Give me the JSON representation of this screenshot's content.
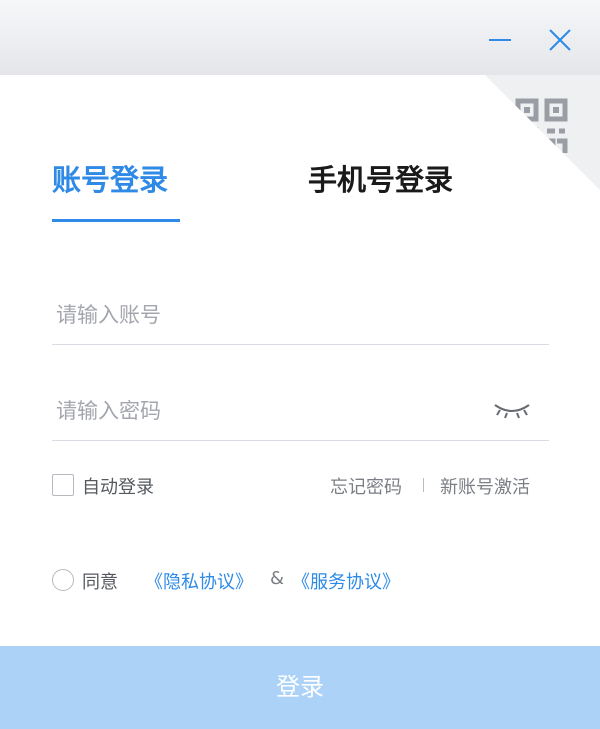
{
  "window": {
    "minimize_icon": "minimize-icon",
    "close_icon": "close-icon"
  },
  "qr_login": {
    "icon": "qr-code-icon"
  },
  "tabs": [
    {
      "label": "账号登录",
      "active": true
    },
    {
      "label": "手机号登录",
      "active": false
    }
  ],
  "form": {
    "account_placeholder": "请输入账号",
    "account_value": "",
    "password_placeholder": "请输入密码",
    "password_value": "",
    "password_toggle_icon": "eye-closed-icon"
  },
  "options": {
    "auto_login_label": "自动登录",
    "auto_login_checked": false,
    "forgot_password": "忘记密码",
    "separator": "|",
    "activate_account": "新账号激活"
  },
  "agreement": {
    "prefix": "同意",
    "privacy": "《隐私协议》",
    "and": "&",
    "service": "《服务协议》",
    "checked": false
  },
  "login_button": "登录",
  "colors": {
    "accent": "#2e8ae6",
    "button_disabled": "#acd2f8",
    "titlebar": "#e9ebee"
  }
}
